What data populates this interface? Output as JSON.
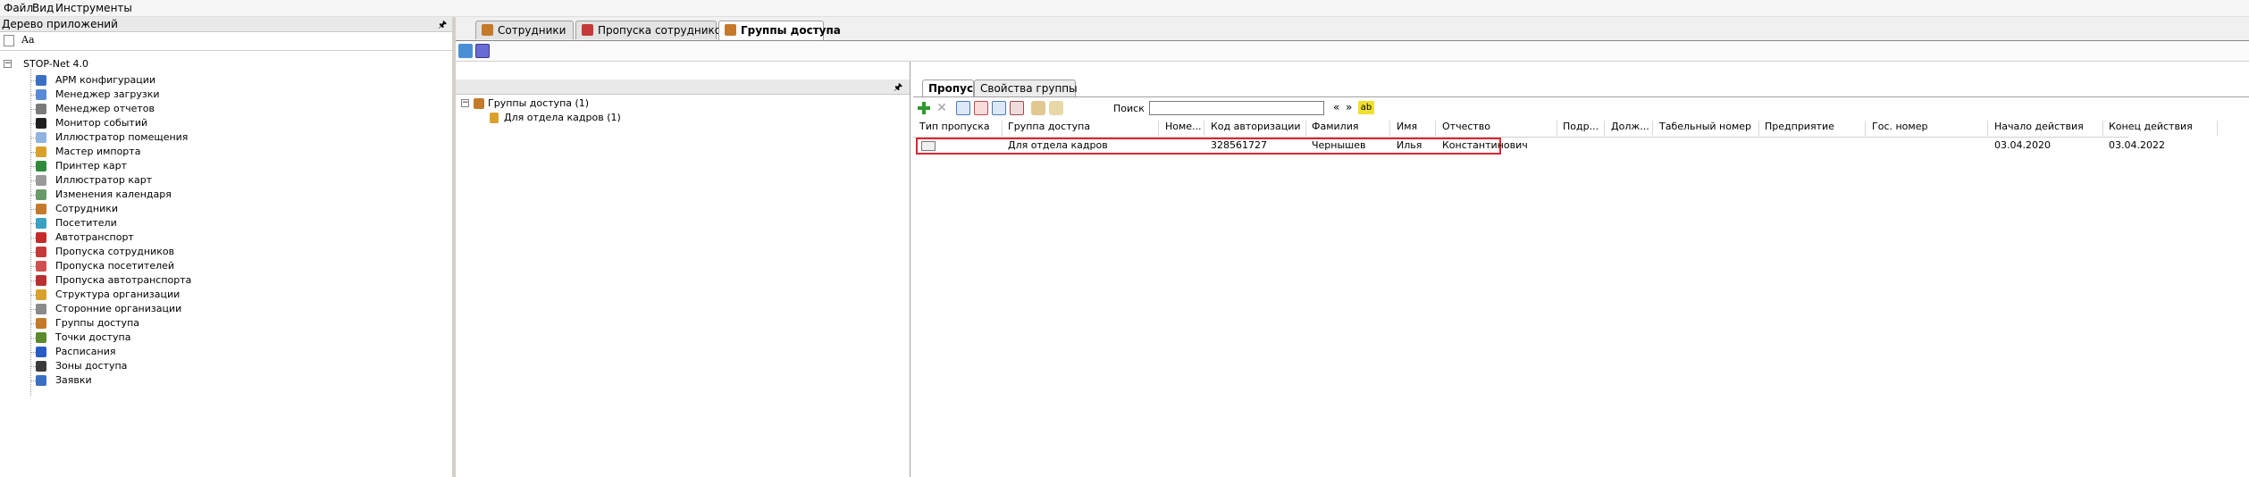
{
  "menu": {
    "items": [
      "Файл",
      "Вид",
      "Инструменты"
    ]
  },
  "left_panel": {
    "title": "Дерево приложений",
    "toolbar_label": "Aa",
    "root": "STOP-Net 4.0",
    "items": [
      {
        "label": "АРМ конфигурации",
        "icon": "config-icon",
        "color": "#3a6fc4"
      },
      {
        "label": "Менеджер загрузки",
        "icon": "download-manager-icon",
        "color": "#5b8ad6"
      },
      {
        "label": "Менеджер отчетов",
        "icon": "report-manager-icon",
        "color": "#7a7a7a"
      },
      {
        "label": "Монитор событий",
        "icon": "event-monitor-icon",
        "color": "#1f1f1f"
      },
      {
        "label": "Иллюстратор помещения",
        "icon": "room-illustrator-icon",
        "color": "#8fb3e0"
      },
      {
        "label": "Мастер импорта",
        "icon": "import-wizard-icon",
        "color": "#d9a12b"
      },
      {
        "label": "Принтер карт",
        "icon": "card-printer-icon",
        "color": "#2f8a3a"
      },
      {
        "label": "Иллюстратор карт",
        "icon": "card-illustrator-icon",
        "color": "#9a9a9a"
      },
      {
        "label": "Изменения календаря",
        "icon": "calendar-icon",
        "color": "#6a9a6a"
      },
      {
        "label": "Сотрудники",
        "icon": "employees-icon",
        "color": "#c47a2a"
      },
      {
        "label": "Посетители",
        "icon": "visitors-icon",
        "color": "#3aa0c4"
      },
      {
        "label": "Автотранспорт",
        "icon": "vehicle-icon",
        "color": "#c42a2a"
      },
      {
        "label": "Пропуска сотрудников",
        "icon": "employee-pass-icon",
        "color": "#c43a3a"
      },
      {
        "label": "Пропуска посетителей",
        "icon": "visitor-pass-icon",
        "color": "#d05050"
      },
      {
        "label": "Пропуска автотранспорта",
        "icon": "vehicle-pass-icon",
        "color": "#b83030"
      },
      {
        "label": "Структура организации",
        "icon": "org-structure-icon",
        "color": "#d9a12b"
      },
      {
        "label": "Сторонние организации",
        "icon": "external-org-icon",
        "color": "#8a8a8a"
      },
      {
        "label": "Группы доступа",
        "icon": "access-groups-icon",
        "color": "#c47a2a"
      },
      {
        "label": "Точки доступа",
        "icon": "access-points-icon",
        "color": "#5a8a2a"
      },
      {
        "label": "Расписания",
        "icon": "schedule-icon",
        "color": "#2a5ac4"
      },
      {
        "label": "Зоны доступа",
        "icon": "access-zones-icon",
        "color": "#3a3a3a"
      },
      {
        "label": "Заявки",
        "icon": "requests-icon",
        "color": "#3a6fc4"
      }
    ]
  },
  "tabs": [
    {
      "label": "Сотрудники",
      "icon": "employees-icon",
      "active": false
    },
    {
      "label": "Пропуска сотрудников",
      "icon": "employee-pass-icon",
      "active": false
    },
    {
      "label": "Группы доступа",
      "icon": "access-groups-icon",
      "active": true
    }
  ],
  "groups_tree": {
    "root": "Группы доступа (1)",
    "child": "Для отдела кадров (1)"
  },
  "inner_tabs": [
    {
      "label": "Пропуска",
      "active": true
    },
    {
      "label": "Свойства группы",
      "active": false
    }
  ],
  "search": {
    "label": "Поиск",
    "value": "",
    "filter_badge": "ab"
  },
  "grid": {
    "columns": [
      "Тип пропуска",
      "Группа доступа",
      "Номе...",
      "Код авторизации",
      "Фамилия",
      "Имя",
      "Отчество",
      "Подр...",
      "Долж...",
      "Табельный номер",
      "Предприятие",
      "Гос. номер",
      "Начало действия",
      "Конец действия"
    ],
    "rows": [
      {
        "pass_type": "",
        "group": "Для отдела кадров",
        "number": "",
        "auth_code": "328561727",
        "last_name": "Чернышев",
        "first_name": "Илья",
        "patronymic": "Константинович",
        "department": "",
        "position": "",
        "personnel_number": "",
        "company": "",
        "plate": "",
        "start": "03.04.2020",
        "end": "03.04.2022"
      }
    ]
  },
  "colors": {
    "highlight": "#e0242f",
    "accent": "#3a6fc4"
  }
}
